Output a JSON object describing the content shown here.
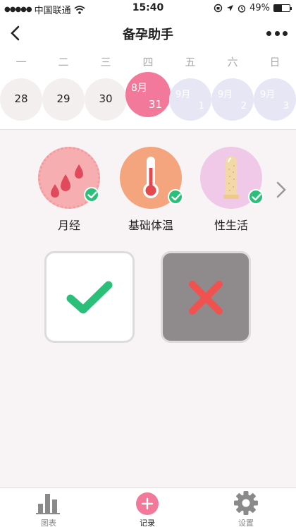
{
  "status": {
    "carrier": "中国联通",
    "time": "15:40",
    "battery": "49%",
    "battery_level": 0.49
  },
  "nav": {
    "title": "备孕助手"
  },
  "week_days": [
    "一",
    "二",
    "三",
    "四",
    "五",
    "六",
    "日"
  ],
  "dates": {
    "d28": "28",
    "d29": "29",
    "d30": "30",
    "selected_month": "8月",
    "selected_day": "31",
    "future_month": "9月",
    "f1": "1",
    "f2": "2",
    "f3": "3"
  },
  "categories": {
    "period": "月经",
    "temperature": "基础体温",
    "intimacy": "性生活"
  },
  "tabs": {
    "chart": "图表",
    "record": "记录",
    "settings": "设置"
  },
  "colors": {
    "accent_pink": "#f3799a",
    "check_green": "#2bbf79",
    "cross_red": "#f0524f"
  }
}
